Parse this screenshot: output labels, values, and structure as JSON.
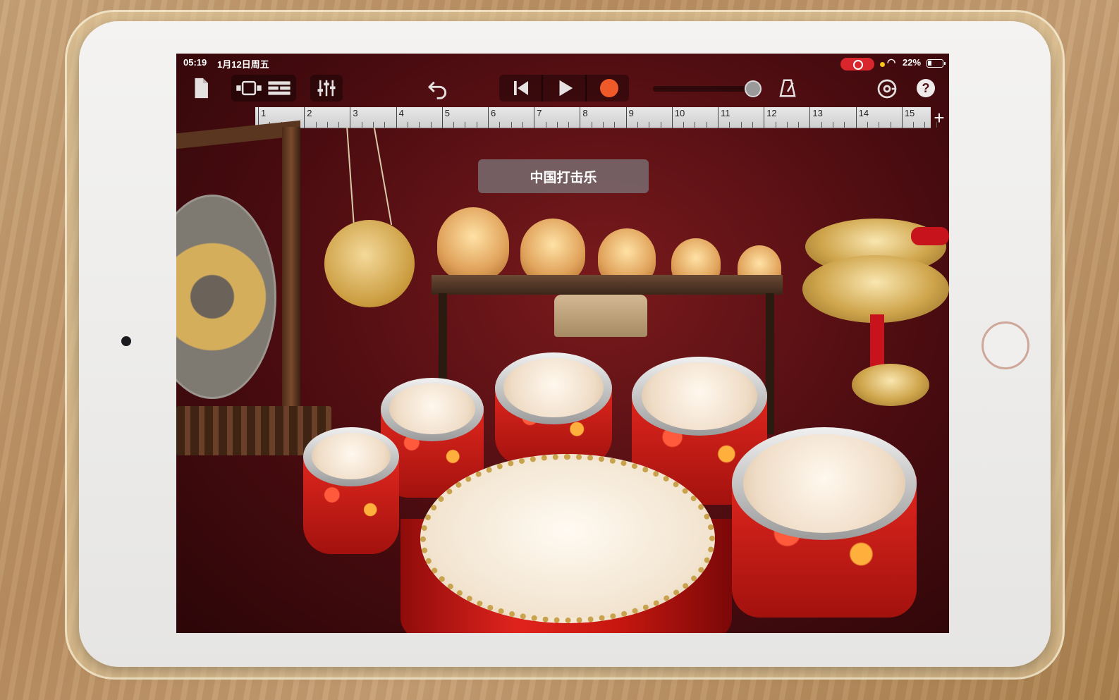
{
  "status_bar": {
    "time": "05:19",
    "date": "1月12日周五",
    "battery": "22%"
  },
  "toolbar": {
    "icons": [
      "document-icon",
      "view-tracks-icon",
      "view-list-icon",
      "mixer-icon",
      "undo-icon",
      "go-to-start-icon",
      "play-icon",
      "record-icon",
      "metronome-icon",
      "settings-icon",
      "help-icon"
    ],
    "help_label": "?",
    "add_label": "+"
  },
  "ruler": {
    "bars": [
      "1",
      "2",
      "3",
      "4",
      "5",
      "6",
      "7",
      "8",
      "9",
      "10",
      "11",
      "12",
      "13",
      "14",
      "15"
    ]
  },
  "instrument": {
    "name": "中国打击乐"
  },
  "colors": {
    "record": "#f05a28",
    "stage_background": "#5a0f13",
    "recording_indicator": "#d8262c"
  }
}
